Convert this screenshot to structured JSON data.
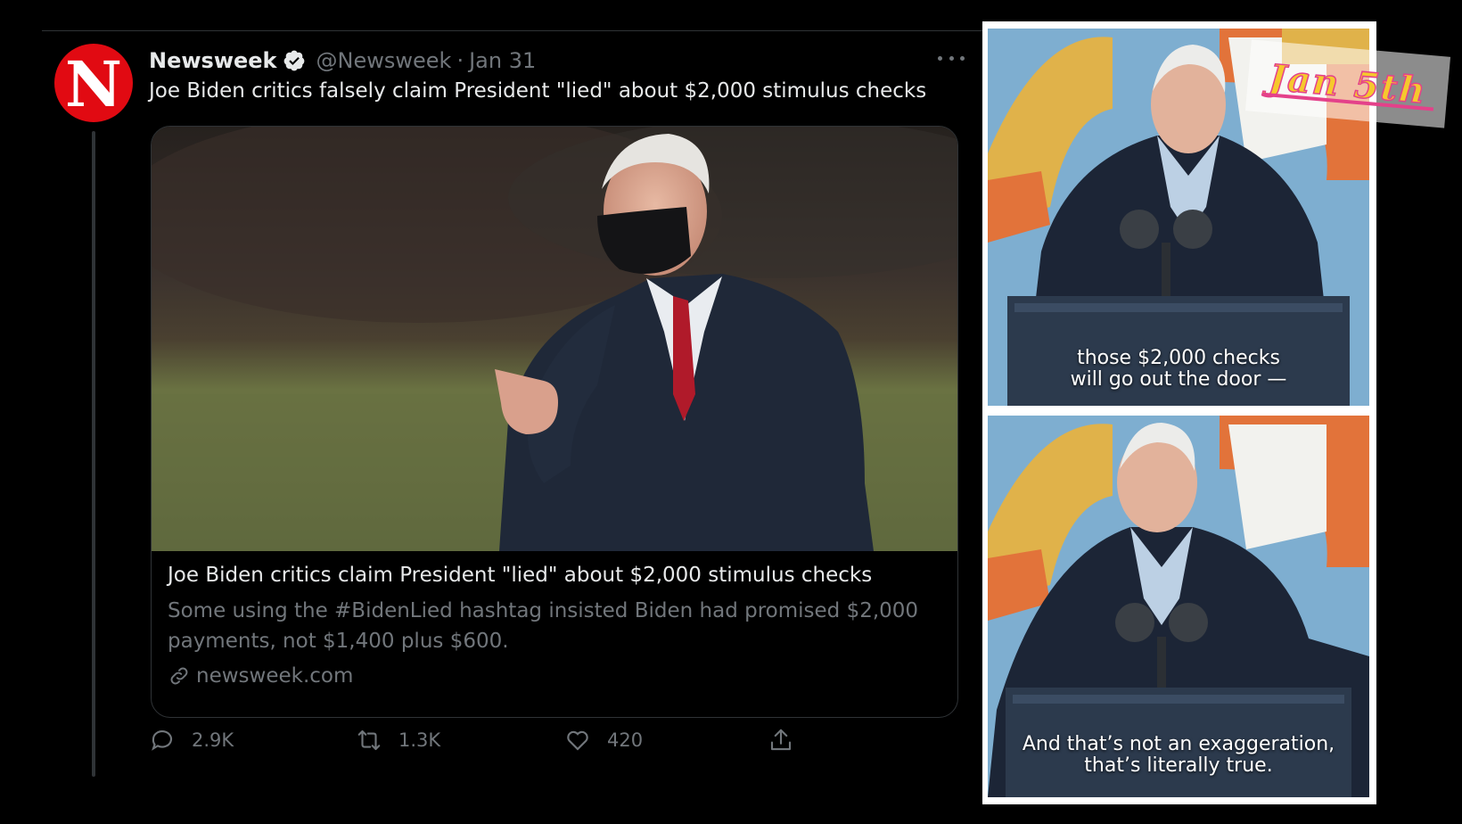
{
  "colors": {
    "background": "#000000",
    "newsweek_red": "#e10a12",
    "verified_badge": "#e7e9ea",
    "muted_text": "#71767b",
    "primary_text": "#e7e9ea",
    "sticker_yellow": "#f6c82d",
    "sticker_pink": "#e4418a"
  },
  "tweet": {
    "avatar_letter": "N",
    "display_name": "Newsweek",
    "handle": "@Newsweek",
    "separator": "·",
    "date": "Jan 31",
    "text": "Joe Biden critics falsely claim President \"lied\" about $2,000 stimulus checks",
    "card": {
      "title": "Joe Biden critics claim President \"lied\" about $2,000 stimulus checks",
      "description": "Some using the #BidenLied hashtag insisted Biden had promised $2,000 payments, not $1,400 plus $600.",
      "domain": "newsweek.com"
    },
    "actions": {
      "replies": "2.9K",
      "retweets": "1.3K",
      "likes": "420"
    }
  },
  "panels": {
    "top_caption_line1": "those $2,000 checks",
    "top_caption_line2": "will go out the door —",
    "bottom_caption_line1": "And that’s not an exaggeration,",
    "bottom_caption_line2": "that’s literally true.",
    "date_sticker": "Jan 5th"
  }
}
